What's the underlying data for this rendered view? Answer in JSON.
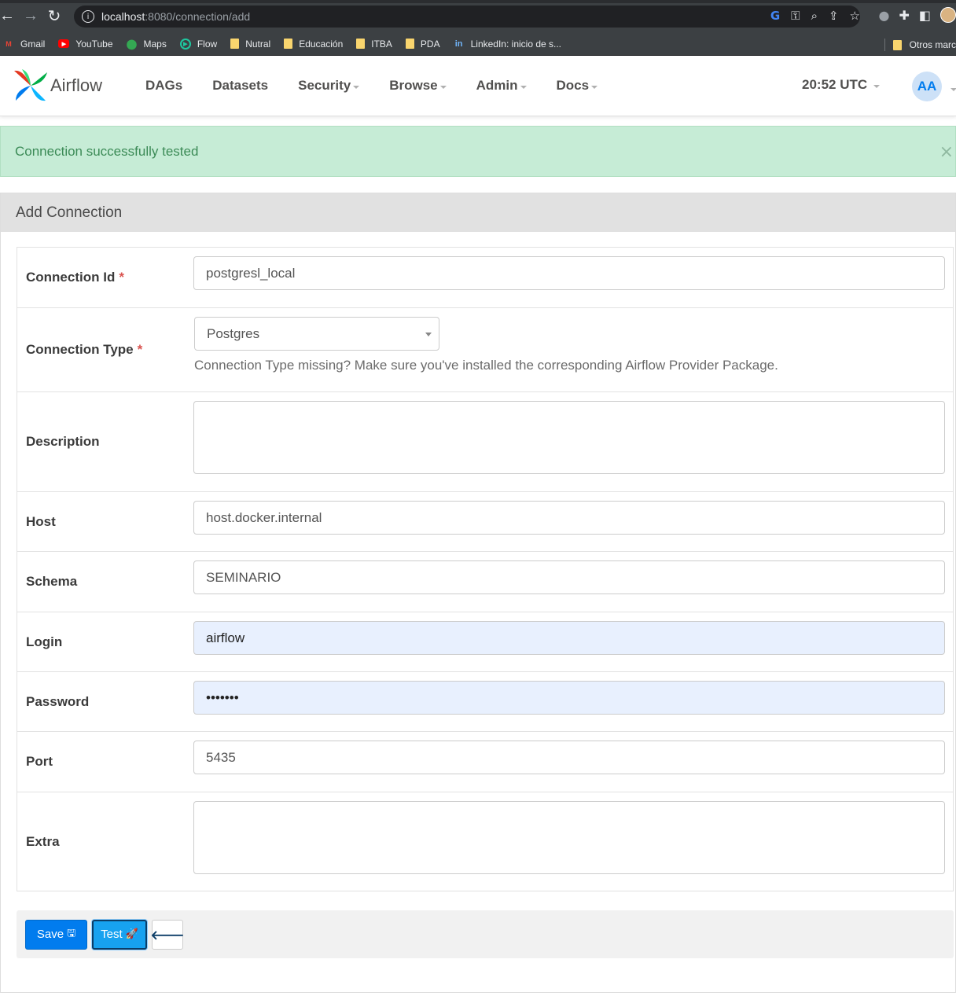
{
  "browser": {
    "url_host": "localhost",
    "url_path": ":8080/connection/add",
    "bookmarks": [
      {
        "label": "Gmail",
        "icon": "gmail-icon"
      },
      {
        "label": "YouTube",
        "icon": "youtube-icon"
      },
      {
        "label": "Maps",
        "icon": "maps-icon"
      },
      {
        "label": "Flow",
        "icon": "flow-icon"
      },
      {
        "label": "Nutral",
        "icon": "folder-icon"
      },
      {
        "label": "Educación",
        "icon": "folder-icon"
      },
      {
        "label": "ITBA",
        "icon": "folder-icon"
      },
      {
        "label": "PDA",
        "icon": "folder-icon"
      },
      {
        "label": "LinkedIn: inicio de s...",
        "icon": "linkedin-icon"
      }
    ],
    "other_bookmarks": "Otros marc"
  },
  "navbar": {
    "brand": "Airflow",
    "items": [
      "DAGs",
      "Datasets",
      "Security",
      "Browse",
      "Admin",
      "Docs"
    ],
    "time": "20:52 UTC",
    "avatar": "AA"
  },
  "alert": {
    "message": "Connection successfully tested",
    "close": "×"
  },
  "panel": {
    "title": "Add Connection"
  },
  "form": {
    "conn_id": {
      "label": "Connection Id",
      "required": "*",
      "value": "postgresl_local"
    },
    "conn_type": {
      "label": "Connection Type",
      "required": "*",
      "value": "Postgres",
      "help": "Connection Type missing? Make sure you've installed the corresponding Airflow Provider Package."
    },
    "description": {
      "label": "Description",
      "value": ""
    },
    "host": {
      "label": "Host",
      "value": "host.docker.internal"
    },
    "schema": {
      "label": "Schema",
      "value": "SEMINARIO"
    },
    "login": {
      "label": "Login",
      "value": "airflow"
    },
    "password": {
      "label": "Password",
      "value": "•••••••"
    },
    "port": {
      "label": "Port",
      "value": "5435"
    },
    "extra": {
      "label": "Extra",
      "value": ""
    }
  },
  "actions": {
    "save": "Save",
    "test": "Test"
  },
  "colors": {
    "primary": "#017cee",
    "alert_bg": "#c6ecd6",
    "alert_text": "#3c8b57",
    "required": "#d9534f"
  }
}
